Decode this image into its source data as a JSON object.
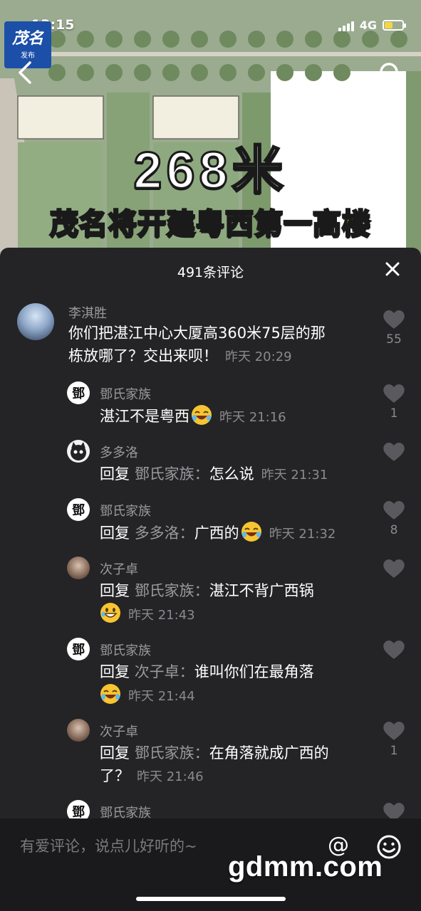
{
  "status": {
    "time": "13:15",
    "network": "4G"
  },
  "logo": {
    "main": "茂名",
    "sub": "发布"
  },
  "video": {
    "headline_number": "268米",
    "headline_text": "茂名将开建粤西第一高楼"
  },
  "comments_sheet": {
    "title": "491条评论",
    "comments": [
      {
        "user": "李淇胜",
        "text": "你们把湛江中心大厦高360米75层的那栋放哪了？交出来呗！",
        "text_line1": "你们把湛江中心大厦高360米75层的那",
        "text_line2": "栋放哪了？交出来呗！",
        "time": "昨天 20:29",
        "likes": "55"
      },
      {
        "user": "鄧氏家族",
        "text": "湛江不是粤西",
        "time": "昨天 21:16",
        "likes": "1"
      },
      {
        "user": "多多洛",
        "reply_prefix": "回复",
        "reply_to": "鄧氏家族：",
        "text": "怎么说",
        "time": "昨天 21:31",
        "likes": ""
      },
      {
        "user": "鄧氏家族",
        "reply_prefix": "回复",
        "reply_to": "多多洛：",
        "text": "广西的",
        "time": "昨天 21:32",
        "likes": "8"
      },
      {
        "user": "次子卓",
        "reply_prefix": "回复",
        "reply_to": "鄧氏家族：",
        "text": "湛江不背广西锅",
        "time": "昨天 21:43",
        "likes": ""
      },
      {
        "user": "鄧氏家族",
        "reply_prefix": "回复",
        "reply_to": "次子卓：",
        "text": "谁叫你们在最角落",
        "time": "昨天 21:44",
        "likes": ""
      },
      {
        "user": "次子卓",
        "reply_prefix": "回复",
        "reply_to": "鄧氏家族：",
        "text_line1": "在角落就成广西的",
        "text_line2": "了？",
        "time": "昨天 21:46",
        "likes": "1"
      },
      {
        "user": "鄧氏家族"
      }
    ]
  },
  "input": {
    "placeholder": "有爱评论，说点儿好听的~",
    "at_symbol": "@"
  },
  "watermark": "gdmm.com",
  "colors": {
    "sheet_bg": "#242426",
    "headline_yellow": "#f7d61b",
    "logo_blue": "#1c4fa8"
  },
  "icons": [
    "back-chevron-icon",
    "search-icon",
    "close-icon",
    "heart-icon",
    "emoji-face-icon",
    "laughing-emoji-icon",
    "grinning-emoji-icon"
  ]
}
